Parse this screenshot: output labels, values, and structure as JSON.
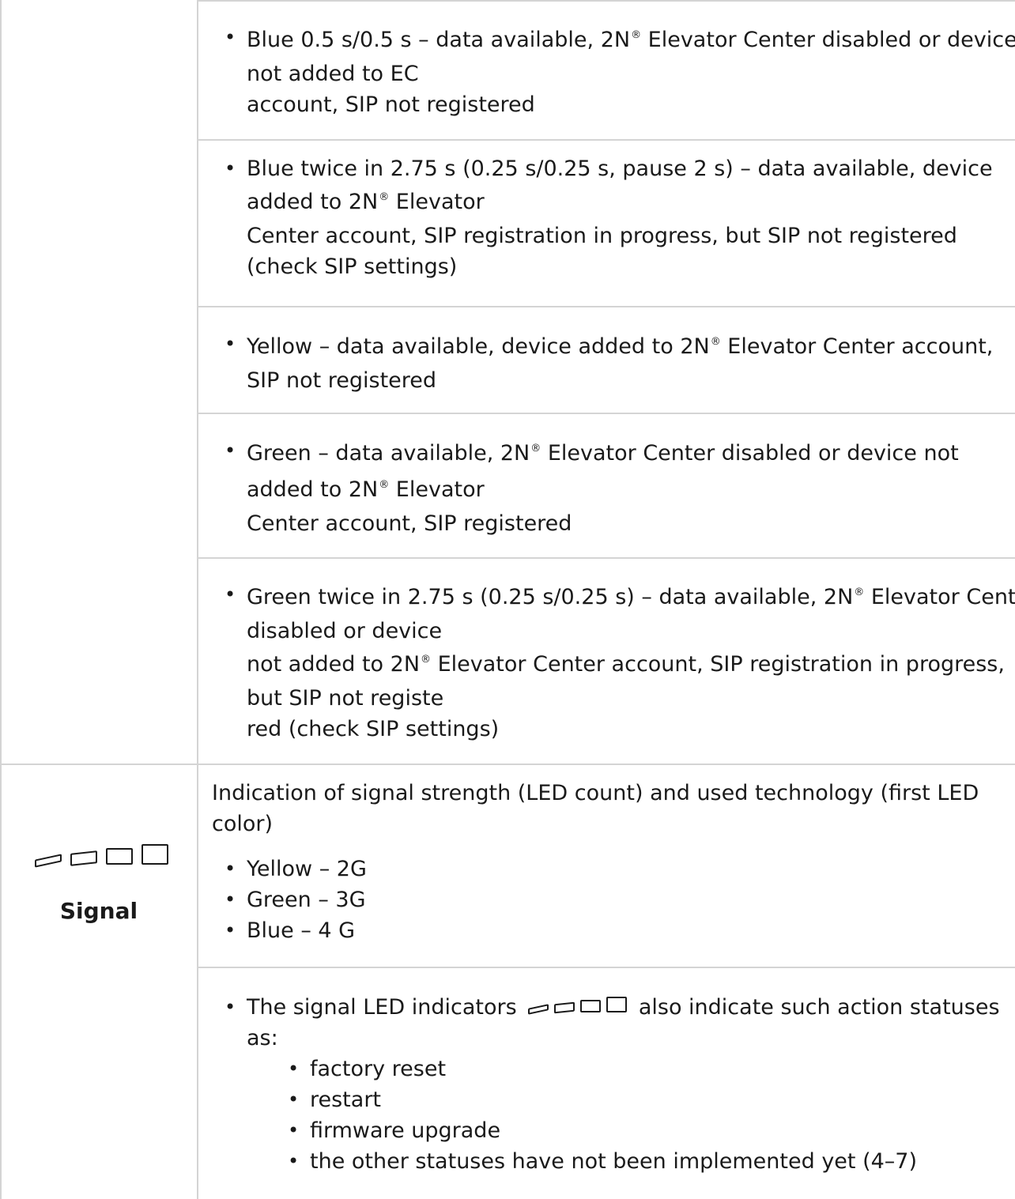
{
  "rows_continued": [
    {
      "lines": [
        [
          "Blue 0.5 s/0.5 s – data available, 2N",
          "®",
          " Elevator Center disabled or device"
        ],
        [
          "not added to EC"
        ],
        [
          "account, SIP not registered"
        ]
      ]
    },
    {
      "lines": [
        [
          "Blue twice in 2.75 s (0.25 s/0.25 s, pause 2 s) – data available, device"
        ],
        [
          "added to 2N",
          "®",
          " Elevator"
        ],
        [
          "Center account, SIP registration in progress, but SIP not registered"
        ],
        [
          "(check SIP settings)"
        ]
      ]
    },
    {
      "lines": [
        [
          "Yellow – data available, device added to 2N",
          "®",
          " Elevator Center account,"
        ],
        [
          "SIP not registered"
        ]
      ]
    },
    {
      "lines": [
        [
          "Green – data available, 2N",
          "®",
          " Elevator Center disabled or device not"
        ],
        [
          "added to 2N",
          "®",
          " Elevator"
        ],
        [
          "Center account, SIP registered"
        ]
      ]
    },
    {
      "lines": [
        [
          "Green twice in 2.75 s (0.25 s/0.25 s) – data available, 2N",
          "®",
          " Elevator Center"
        ],
        [
          "disabled or device"
        ],
        [
          "not added to 2N",
          "®",
          " Elevator Center account, SIP registration in progress,"
        ],
        [
          "but SIP not registe"
        ],
        [
          "red (check SIP settings)"
        ]
      ]
    }
  ],
  "signal": {
    "icon": "signal-bars-icon",
    "label": "Signal",
    "description_line1": "Indication of signal strength (LED count) and used technology (first LED",
    "description_line2": "color)",
    "technologies": [
      "Yellow – 2G",
      "Green – 3G",
      "Blue – 4 G"
    ],
    "actions_intro_before": "The signal LED indicators",
    "actions_intro_after": "also indicate such action statuses",
    "actions_intro_line2": "as:",
    "actions": [
      "factory reset",
      "restart",
      "firmware upgrade",
      "the other statuses have not been implemented yet (4–7)"
    ]
  }
}
